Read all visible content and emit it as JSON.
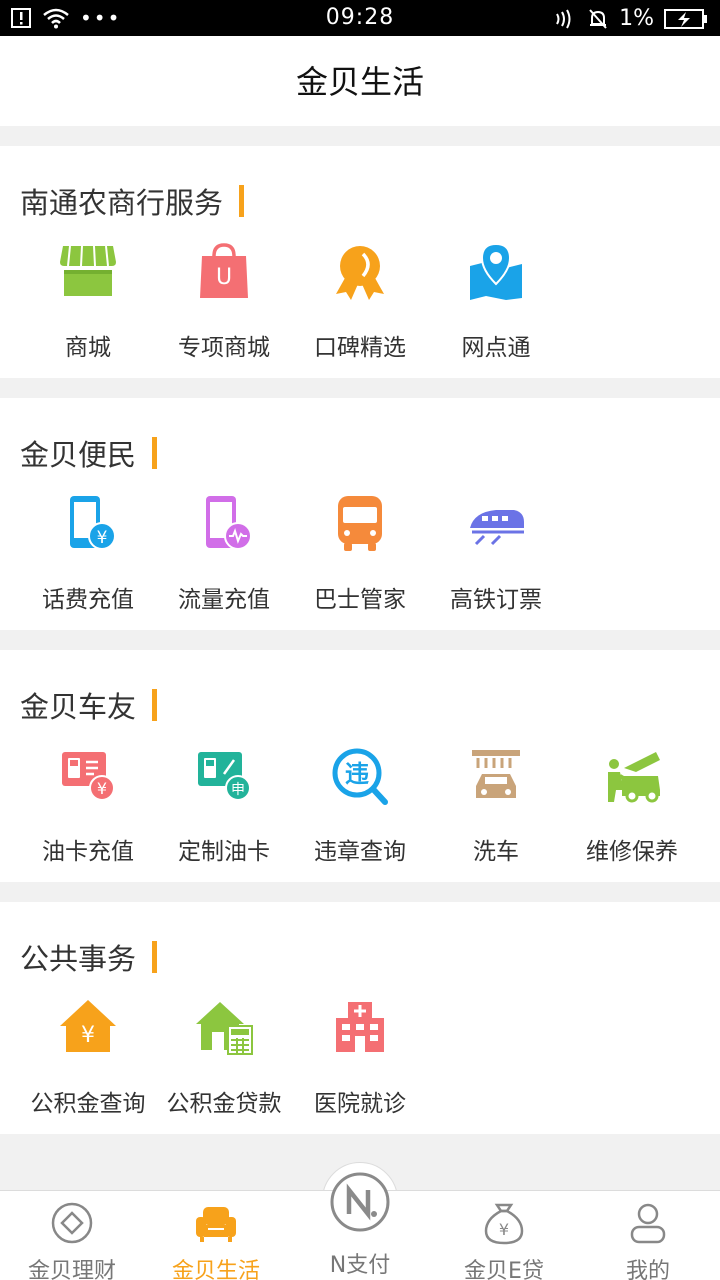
{
  "status_bar": {
    "time": "09:28",
    "battery": "1%"
  },
  "header": {
    "title": "金贝生活"
  },
  "sections": [
    {
      "title": "南通农商行服务",
      "items": [
        {
          "label": "商城",
          "icon": "store-icon",
          "color": "#8cc63f"
        },
        {
          "label": "专项商城",
          "icon": "shopping-bag-icon",
          "color": "#f46f73",
          "glyph": "U"
        },
        {
          "label": "口碑精选",
          "icon": "medal-icon",
          "color": "#f7a21b"
        },
        {
          "label": "网点通",
          "icon": "map-pin-icon",
          "color": "#1aa3e8"
        }
      ]
    },
    {
      "title": "金贝便民",
      "items": [
        {
          "label": "话费充值",
          "icon": "phone-recharge-icon",
          "color": "#1aa3e8",
          "glyph": "¥"
        },
        {
          "label": "流量充值",
          "icon": "data-recharge-icon",
          "color": "#d16ee8"
        },
        {
          "label": "巴士管家",
          "icon": "bus-icon",
          "color": "#f58a3b"
        },
        {
          "label": "高铁订票",
          "icon": "train-icon",
          "color": "#6b73e6"
        }
      ]
    },
    {
      "title": "金贝车友",
      "items": [
        {
          "label": "油卡充值",
          "icon": "fuel-card-icon",
          "color": "#f46f73",
          "glyph": "¥"
        },
        {
          "label": "定制油卡",
          "icon": "custom-fuel-card-icon",
          "color": "#22b39a",
          "glyph": "申"
        },
        {
          "label": "违章查询",
          "icon": "violation-search-icon",
          "color": "#1aa3e8",
          "glyph": "违"
        },
        {
          "label": "洗车",
          "icon": "car-wash-icon",
          "color": "#c9a47a"
        },
        {
          "label": "维修保养",
          "icon": "car-repair-icon",
          "color": "#8cc63f"
        }
      ]
    },
    {
      "title": "公共事务",
      "items": [
        {
          "label": "公积金查询",
          "icon": "fund-house-icon",
          "color": "#f7a21b",
          "glyph": "¥"
        },
        {
          "label": "公积金贷款",
          "icon": "fund-loan-icon",
          "color": "#8cc63f"
        },
        {
          "label": "医院就诊",
          "icon": "hospital-icon",
          "color": "#f46f73"
        }
      ]
    }
  ],
  "tab_bar": {
    "active_color": "#f7a21b",
    "tabs": [
      {
        "label": "金贝理财",
        "icon": "diamond-icon"
      },
      {
        "label": "金贝生活",
        "icon": "sofa-icon",
        "active": true
      },
      {
        "label": "N支付",
        "icon": "n-pay-icon",
        "glyph": "N."
      },
      {
        "label": "金贝E贷",
        "icon": "money-bag-icon",
        "glyph": "¥"
      },
      {
        "label": "我的",
        "icon": "user-icon"
      }
    ]
  }
}
